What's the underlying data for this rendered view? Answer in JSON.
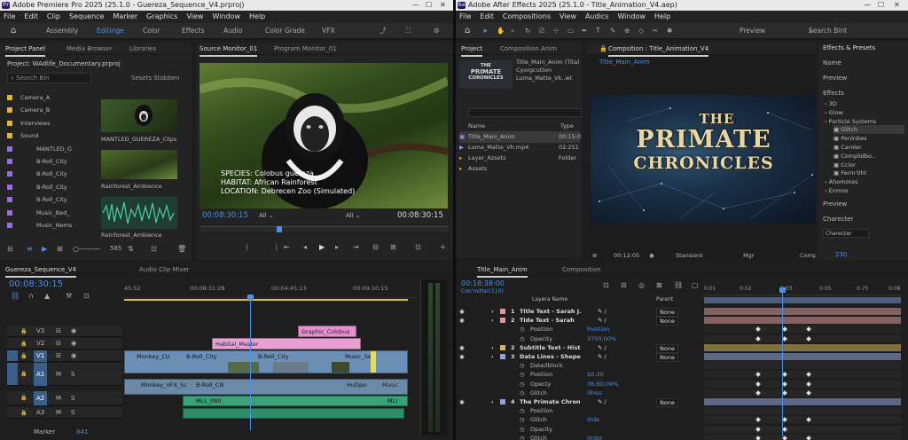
{
  "premiere": {
    "title": "Adobe Premiere Pro 2025 (25.1.0 - Guereza_Sequence_V4.prproj)",
    "menu": [
      "File",
      "Edit",
      "Clip",
      "Sequence",
      "Marker",
      "Graphics",
      "View",
      "Window",
      "Help"
    ],
    "workspaces": [
      "Assembly",
      "Editing",
      "Color",
      "Effects",
      "Audio",
      "Color Grade",
      "VFX"
    ],
    "project": {
      "tabs": [
        "Project Panel",
        "Media Browser",
        "Libraries"
      ],
      "path": "Project: WAdlife_Documentary.prproj",
      "search": "Search Bin",
      "sets": "Sesets Stobben",
      "items": [
        {
          "name": "Camera_A",
          "color": "#e0b43a"
        },
        {
          "name": "Camera_B",
          "color": "#e0b43a"
        },
        {
          "name": "Interviews",
          "color": "#e0b43a"
        },
        {
          "name": "Sound",
          "color": "#e0b43a"
        },
        {
          "name": "MANTLED_G",
          "color": "#9b6be0"
        },
        {
          "name": "B-Roll_City",
          "color": "#9b6be0"
        },
        {
          "name": "B-Roll_City",
          "color": "#9b6be0"
        },
        {
          "name": "B-Roll_City",
          "color": "#9b6be0"
        },
        {
          "name": "B-Roll_City",
          "color": "#9b6be0"
        },
        {
          "name": "Music_Bed_",
          "color": "#9b6be0"
        },
        {
          "name": "Music_Nems",
          "color": "#9b6be0"
        }
      ],
      "thumbs": [
        "MANTLED_GUEREZA_Clips",
        "Rainforest_Ambience",
        "Rainforest_Ambience"
      ],
      "zoom": "585"
    },
    "monitor": {
      "tabs": [
        "Source Monitor_01",
        "Program Monitor_01"
      ],
      "overlay": [
        "SPECIES: Colobus guereza",
        "HABITAT: African Rainforest",
        "LOCATION: Debrecen Zoo (Simulated)"
      ],
      "tc_in": "00:08:30:15",
      "tc_out": "00:08:30:15",
      "fit": "All",
      "res": "All"
    },
    "timeline": {
      "title": "Guereza_Sequence_V4",
      "mixer": "Audio Clip Mixer",
      "timecode": "00:08:30:15",
      "ruler": [
        "45:52",
        "00:08:31:28",
        "00:04:45:13",
        "00:09:10:15"
      ],
      "tracks": [
        "V3",
        "V2",
        "V1",
        "A1",
        "A2",
        "A3"
      ],
      "clips": {
        "graphic": "Graphic_Colobus",
        "habitat": "Habital_Master",
        "monkey": "Monkey_CU",
        "broll1": "B-Roll_City",
        "broll2": "B-Roll_City",
        "music": "Music_Sec",
        "monkeyvfx": "Monkey_VFX_Sc",
        "broll3": "B-Roll_CN",
        "hud": "HuDpo",
        "music2": "Music",
        "mll": "MLL_080",
        "mli": "MLI"
      },
      "marker": "Marker",
      "marker_val": "841"
    }
  },
  "aftereffects": {
    "title": "Adobe After Effects 2025 (25.1.0 - Title_Animation_V4.aep)",
    "menu": [
      "File",
      "Edit",
      "Compositions",
      "View",
      "Audics",
      "Window",
      "Help"
    ],
    "search": "Search Bint",
    "preview": "Preview",
    "project": {
      "tabs": [
        "Project",
        "Composition Anim"
      ],
      "thumb_text": [
        "THE",
        "PRIMATE",
        "CORONICLES"
      ],
      "selected": "Title_Main_Anim",
      "selected_meta": [
        "Title_Main_Anim (Tital",
        "Cyorgcutten",
        "Luma_Matte_Vk..wt"
      ],
      "cols": [
        "Name",
        "Type"
      ],
      "items": [
        {
          "name": "Title_Main_Anim",
          "type": "00:15:03"
        },
        {
          "name": "Luma_Matte_Vh.mp4",
          "type": "02:251"
        },
        {
          "name": "Layer_Azsets",
          "type": "Folder"
        },
        {
          "name": "Assets",
          "type": ""
        }
      ]
    },
    "comp": {
      "tab": "Compsition : Title_Animation_V4",
      "sub": "Title_Main_Anim",
      "title_lines": [
        "THE",
        "PRIMATE",
        "CHRONICLES"
      ],
      "footer_tc": "00:12:05",
      "footer_q": "Stansient",
      "footer_r": "Mgr",
      "footer_c": "Comp"
    },
    "effects": {
      "header": "Effects & Presets",
      "sections": [
        "Name",
        "Preview",
        "Effects"
      ],
      "tree": [
        "3D",
        "Glow",
        "Particle Systems",
        "Glitch",
        "Penlnbes",
        "Caroler",
        "Complidbo..",
        "Cclor",
        "Ferm'tlht",
        "Ahomotes",
        "Enmos"
      ],
      "preview2": "Preview",
      "character": "Charecter",
      "char_val": "Charecter",
      "size": "230"
    },
    "timeline": {
      "tabs": [
        "Title_Main_Anim",
        "Composition"
      ],
      "timecode": "00:18:38:00",
      "sub": "Con'mitter(110)",
      "cols": [
        "Layera Name",
        "Parent"
      ],
      "ruler": [
        "0:01",
        "0:02",
        "0:03",
        "0:05",
        "0:75",
        "0:08"
      ],
      "layers": [
        {
          "n": "1",
          "name": "Title Text - Sarah J.",
          "parent": "None",
          "color": "#d89a9a",
          "top": true
        },
        {
          "n": "2",
          "name": "Tide Text - Sarah",
          "parent": "None",
          "color": "#d89a9a",
          "top": true
        },
        {
          "n": "",
          "name": "Position",
          "val": "Position",
          "prop": true
        },
        {
          "n": "",
          "name": "Opecity",
          "val": "3700;00%",
          "prop": true
        },
        {
          "n": "2",
          "name": "Subtitle Text - Hist",
          "parent": "None",
          "color": "#d6b55a",
          "top": true
        },
        {
          "n": "3",
          "name": "Data Lines - Shepe",
          "parent": "None",
          "color": "#8fa5d8",
          "top": true
        },
        {
          "n": "",
          "name": "Date/lblock",
          "val": "",
          "prop": true
        },
        {
          "n": "",
          "name": "Position",
          "val": "$0,30",
          "prop": true
        },
        {
          "n": "",
          "name": "Opecty",
          "val": "36:80;09%",
          "prop": true
        },
        {
          "n": "",
          "name": "Glitch",
          "val": "0hiss",
          "prop": true
        },
        {
          "n": "4",
          "name": "The Primate Chron",
          "parent": "None",
          "color": "#8fa5d8",
          "top": true
        },
        {
          "n": "",
          "name": "Position",
          "val": "",
          "prop": true
        },
        {
          "n": "",
          "name": "Glitch",
          "val": "0ide",
          "prop": true
        },
        {
          "n": "",
          "name": "Opacity",
          "val": "",
          "prop": true
        },
        {
          "n": "",
          "name": "Glitch",
          "val": "0rdor",
          "prop": true
        }
      ]
    }
  }
}
